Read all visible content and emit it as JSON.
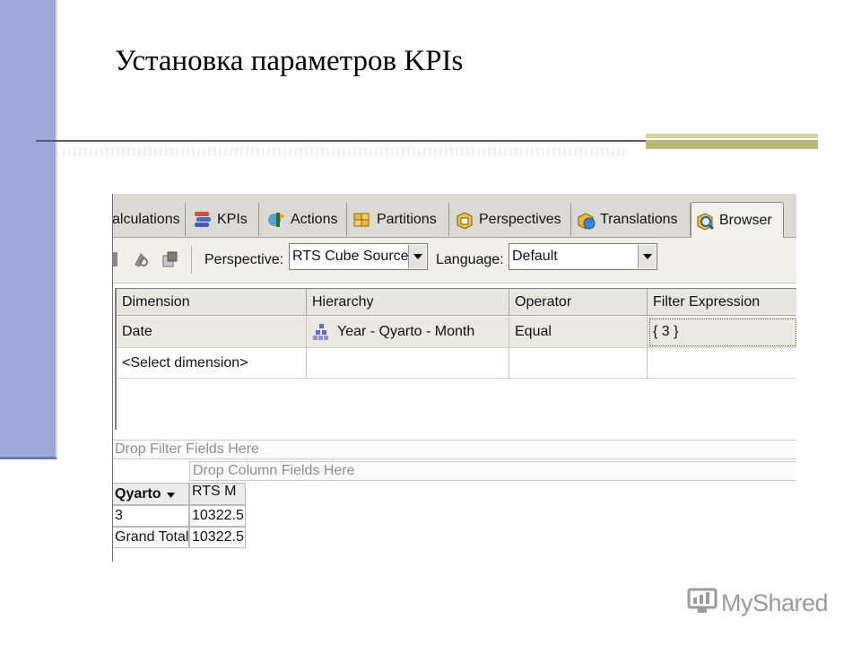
{
  "slide": {
    "title": "Установка параметров KPIs"
  },
  "tabs": [
    {
      "label": "alculations",
      "icon": "calculations-icon"
    },
    {
      "label": "KPIs",
      "icon": "kpis-icon"
    },
    {
      "label": "Actions",
      "icon": "actions-icon"
    },
    {
      "label": "Partitions",
      "icon": "partitions-icon"
    },
    {
      "label": "Perspectives",
      "icon": "perspectives-icon"
    },
    {
      "label": "Translations",
      "icon": "translations-icon"
    },
    {
      "label": "Browser",
      "icon": "browser-icon",
      "active": true
    }
  ],
  "toolbar": {
    "perspective_label": "Perspective:",
    "perspective_value": "RTS Cube Source",
    "language_label": "Language:",
    "language_value": "Default"
  },
  "filter_grid": {
    "columns": [
      "Dimension",
      "Hierarchy",
      "Operator",
      "Filter Expression"
    ],
    "rows": [
      {
        "dimension": "Date",
        "hierarchy": "Year - Qyarto - Month",
        "operator": "Equal",
        "filter_expression": "{ 3 }"
      },
      {
        "dimension": "<Select dimension>",
        "hierarchy": "",
        "operator": "",
        "filter_expression": ""
      }
    ]
  },
  "pivot": {
    "drop_filter_text": "Drop Filter Fields Here",
    "drop_column_text": "Drop Column Fields Here",
    "row_header": "Qyarto",
    "measure_header": "RTS M",
    "rows": [
      {
        "label": "3",
        "value": "10322.5"
      },
      {
        "label": "Grand Total",
        "value": "10322.5"
      }
    ]
  },
  "watermark": {
    "text": "MyShared"
  },
  "colors": {
    "left_band": "#9ea9d8",
    "rule_line": "#4e5b7c",
    "rule_block": "#b7b779",
    "tab_bar": "#dcdad4",
    "active_tab": "#f3f1ec"
  }
}
